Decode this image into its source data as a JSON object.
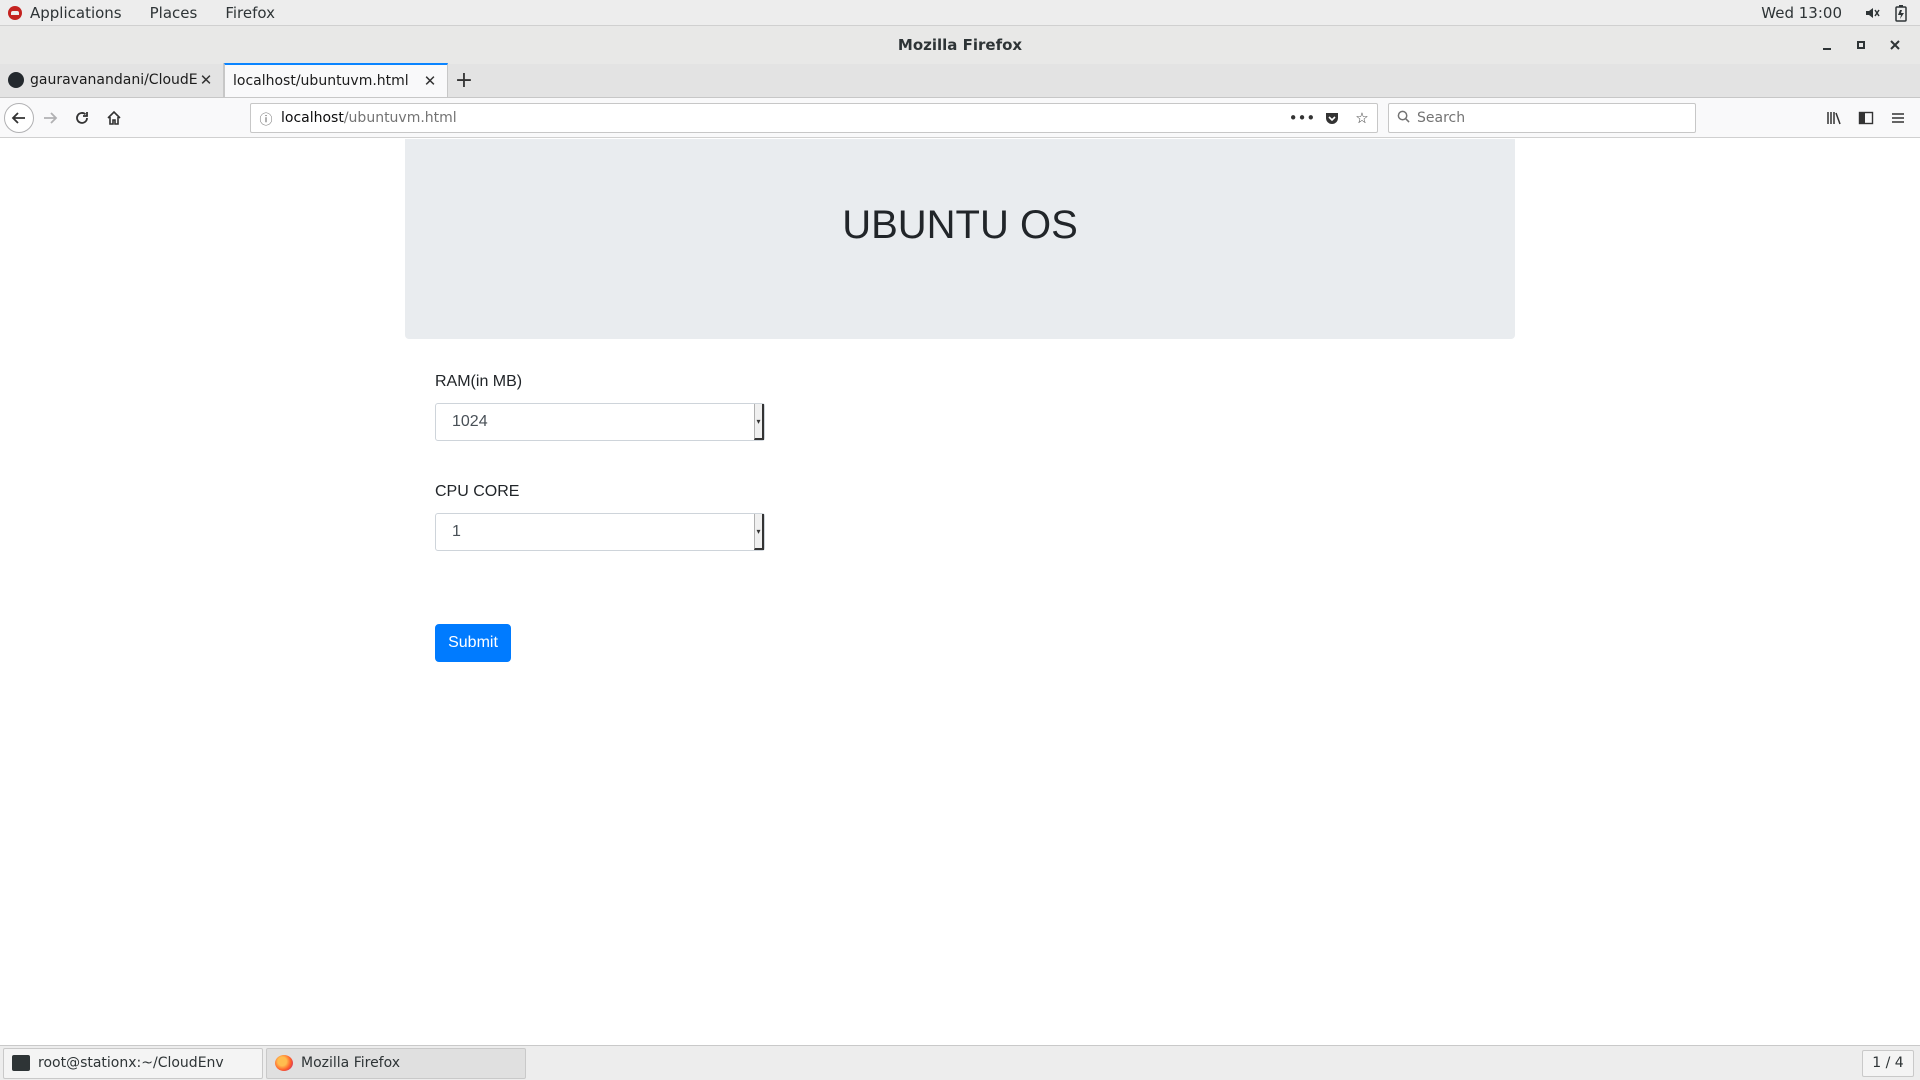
{
  "topbar": {
    "menus": [
      "Applications",
      "Places",
      "Firefox"
    ],
    "clock": "Wed 13:00",
    "icons": [
      "volume-icon",
      "battery-icon"
    ]
  },
  "window": {
    "title": "Mozilla Firefox"
  },
  "tabs": [
    {
      "label": "gauravanandani/CloudEnv",
      "active": false,
      "icon": "github-icon"
    },
    {
      "label": "localhost/ubuntuvm.html",
      "active": true,
      "icon": ""
    }
  ],
  "navbar": {
    "url_host": "localhost",
    "url_path": "/ubuntuvm.html",
    "search_placeholder": "Search"
  },
  "page": {
    "heading": "UBUNTU OS",
    "ram_label": "RAM(in MB)",
    "ram_value": "1024",
    "cpu_label": "CPU CORE",
    "cpu_value": "1",
    "submit_label": "Submit",
    "accent": "#007bff",
    "jumbotron_bg": "#e9ecef"
  },
  "taskbar": {
    "items": [
      {
        "label": "root@stationx:~/CloudEnv",
        "icon": "terminal-icon"
      },
      {
        "label": "Mozilla Firefox",
        "icon": "firefox-icon"
      }
    ],
    "workspace": "1 / 4"
  }
}
